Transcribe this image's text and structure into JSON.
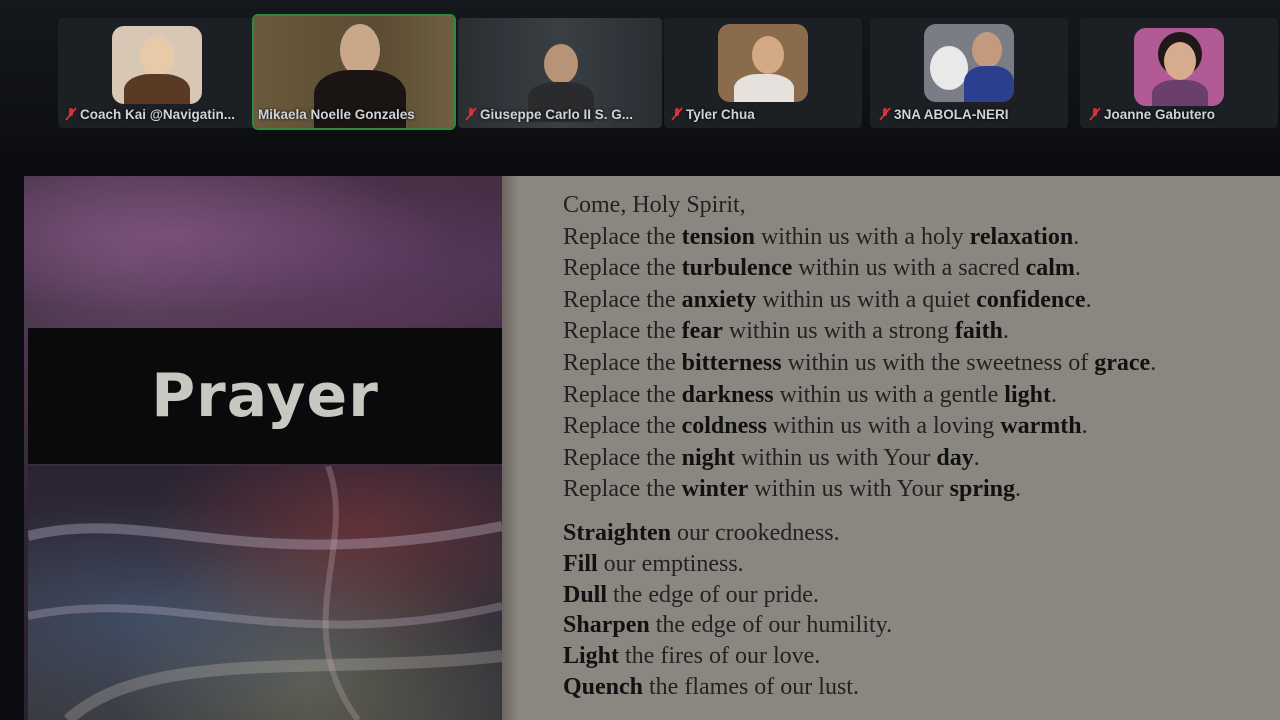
{
  "participants": [
    {
      "name": "Coach Kai @Navigatin...",
      "muted": true
    },
    {
      "name": "Mikaela Noelle Gonzales",
      "muted": false,
      "active": true
    },
    {
      "name": "Giuseppe Carlo II S. G...",
      "muted": true
    },
    {
      "name": "Tyler Chua",
      "muted": true
    },
    {
      "name": "3NA ABOLA-NERI",
      "muted": true
    },
    {
      "name": "Joanne Gabutero",
      "muted": true
    }
  ],
  "slide": {
    "title": "Prayer",
    "lines_a": [
      {
        "pre": "Come, Holy Spirit,",
        "b1": "",
        "mid": "",
        "b2": "",
        "end": ""
      },
      {
        "pre": "Replace the ",
        "b1": "tension",
        "mid": " within us with a holy ",
        "b2": "relaxation",
        "end": "."
      },
      {
        "pre": "Replace the ",
        "b1": "turbulence",
        "mid": " within us with a sacred ",
        "b2": "calm",
        "end": "."
      },
      {
        "pre": "Replace the ",
        "b1": "anxiety",
        "mid": " within us with a quiet ",
        "b2": "confidence",
        "end": "."
      },
      {
        "pre": "Replace the ",
        "b1": "fear",
        "mid": " within us with a strong ",
        "b2": "faith",
        "end": "."
      },
      {
        "pre": "Replace the ",
        "b1": "bitterness",
        "mid": " within us with the sweetness of ",
        "b2": "grace",
        "end": "."
      },
      {
        "pre": "Replace the ",
        "b1": "darkness",
        "mid": " within us with a gentle ",
        "b2": "light",
        "end": "."
      },
      {
        "pre": "Replace the ",
        "b1": "coldness",
        "mid": " within us with a loving ",
        "b2": "warmth",
        "end": "."
      },
      {
        "pre": "Replace the ",
        "b1": "night",
        "mid": " within us with Your ",
        "b2": "day",
        "end": "."
      },
      {
        "pre": "Replace the ",
        "b1": "winter",
        "mid": " within us with Your ",
        "b2": "spring",
        "end": "."
      }
    ],
    "lines_b": [
      {
        "b1": "Straighten",
        "rest": " our crookedness."
      },
      {
        "b1": "Fill",
        "rest": " our emptiness."
      },
      {
        "b1": "Dull",
        "rest": " the edge of our pride."
      },
      {
        "b1": "Sharpen",
        "rest": " the edge of our humility."
      },
      {
        "b1": "Light",
        "rest": " the fires of our love."
      },
      {
        "b1": "Quench",
        "rest": " the flames of our lust."
      }
    ]
  }
}
